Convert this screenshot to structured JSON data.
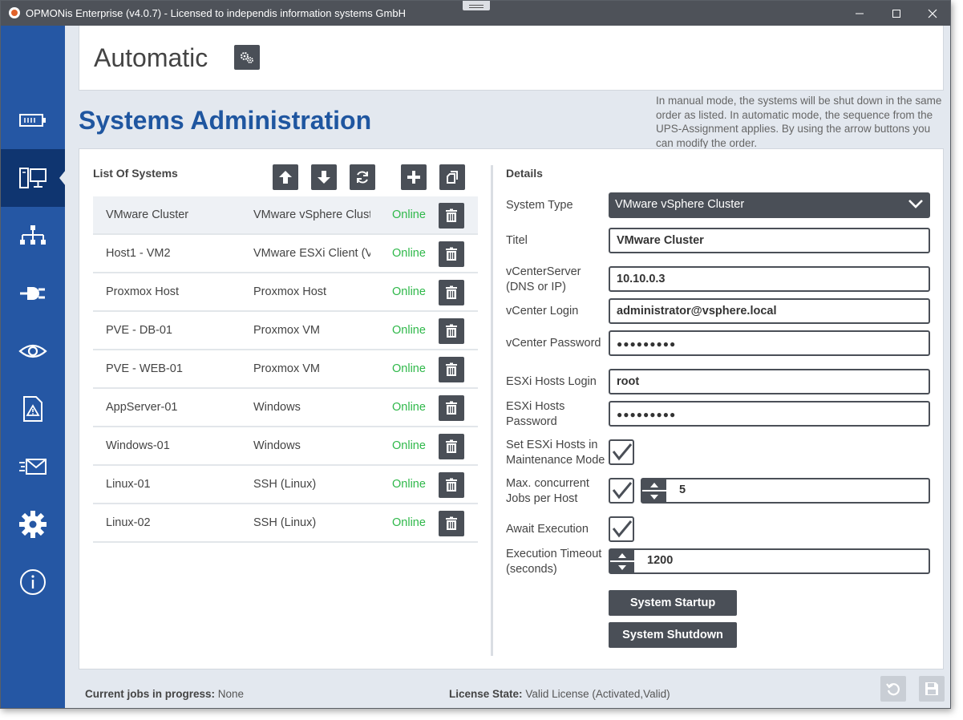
{
  "window": {
    "title": "OPMONis Enterprise (v4.0.7) - Licensed to independis information systems GmbH"
  },
  "header": {
    "mode": "Automatic"
  },
  "page": {
    "title": "Systems Administration",
    "help": "In manual mode, the systems will be shut down in the same order as listed. In automatic mode, the sequence from the UPS-Assignment applies. By using the arrow buttons you can modify the order."
  },
  "list": {
    "title": "List Of Systems",
    "rows": [
      {
        "name": "VMware Cluster",
        "type": "VMware vSphere Cluster",
        "status": "Online"
      },
      {
        "name": "Host1 - VM2",
        "type": "VMware ESXi Client (VM)",
        "status": "Online"
      },
      {
        "name": "Proxmox Host",
        "type": "Proxmox Host",
        "status": "Online"
      },
      {
        "name": "PVE - DB-01",
        "type": "Proxmox VM",
        "status": "Online"
      },
      {
        "name": "PVE - WEB-01",
        "type": "Proxmox VM",
        "status": "Online"
      },
      {
        "name": "AppServer-01",
        "type": "Windows",
        "status": "Online"
      },
      {
        "name": "Windows-01",
        "type": "Windows",
        "status": "Online"
      },
      {
        "name": "Linux-01",
        "type": "SSH (Linux)",
        "status": "Online"
      },
      {
        "name": "Linux-02",
        "type": "SSH (Linux)",
        "status": "Online"
      }
    ]
  },
  "details": {
    "title": "Details",
    "system_type_label": "System Type",
    "system_type_value": "VMware vSphere Cluster",
    "titel_label": "Titel",
    "titel_value": "VMware Cluster",
    "vcenter_server_label": "vCenterServer (DNS or IP)",
    "vcenter_server_value": "10.10.0.3",
    "vcenter_login_label": "vCenter Login",
    "vcenter_login_value": "administrator@vsphere.local",
    "vcenter_password_label": "vCenter Password",
    "vcenter_password_value": "●●●●●●●●●",
    "esxi_login_label": "ESXi Hosts Login",
    "esxi_login_value": "root",
    "esxi_password_label": "ESXi Hosts Password",
    "esxi_password_value": "●●●●●●●●●",
    "maintenance_label": "Set ESXi Hosts in Maintenance Mode",
    "max_jobs_label": "Max. concurrent Jobs per Host",
    "max_jobs_value": "5",
    "await_label": "Await Execution",
    "timeout_label": "Execution Timeout (seconds)",
    "timeout_value": "1200",
    "startup_button": "System Startup",
    "shutdown_button": "System Shutdown"
  },
  "status": {
    "jobs_label": "Current jobs in progress:",
    "jobs_value": "None",
    "license_label": "License State:",
    "license_value": "Valid License (Activated,Valid)"
  },
  "colors": {
    "sidebar": "#2557a4",
    "sidebar_active": "#0f3570",
    "accent": "#1f56a0",
    "button": "#4a4f57",
    "online": "#2fb84a"
  }
}
